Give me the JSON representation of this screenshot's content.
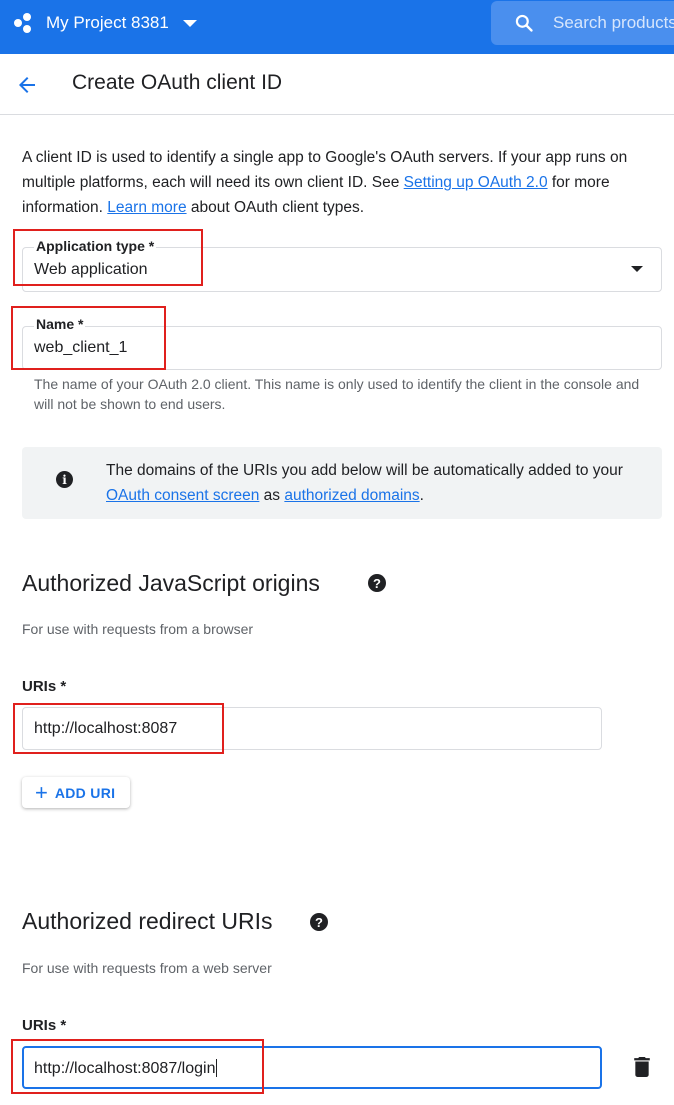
{
  "appbar": {
    "project_name": "My Project 8381",
    "search_placeholder": "Search products",
    "brand_color": "#1a73e8"
  },
  "header": {
    "title": "Create OAuth client ID",
    "back_icon": "arrow-back-icon"
  },
  "intro": {
    "text1": "A client ID is used to identify a single app to Google's OAuth servers. If your app runs on multiple platforms, each will need its own client ID. See ",
    "link1": "Setting up OAuth 2.0",
    "text2": " for more information. ",
    "link2": "Learn more",
    "text3": " about OAuth client types."
  },
  "form": {
    "application_type": {
      "label": "Application type *",
      "value": "Web application"
    },
    "name": {
      "label": "Name *",
      "value": "web_client_1",
      "helper": "The name of your OAuth 2.0 client. This name is only used to identify the client in the console and will not be shown to end users."
    }
  },
  "info": {
    "text1": "The domains of the URIs you add below will be automatically added to your ",
    "link1": "OAuth consent screen",
    "text2": " as ",
    "link2": "authorized domains",
    "text3": "."
  },
  "js_origins": {
    "heading": "Authorized JavaScript origins",
    "subtitle": "For use with requests from a browser",
    "uris_label": "URIs *",
    "uri_value": "http://localhost:8087",
    "add_button": "ADD URI"
  },
  "redirect_uris": {
    "heading": "Authorized redirect URIs",
    "subtitle": "For use with requests from a web server",
    "uris_label": "URIs *",
    "uri_value": "http://localhost:8087/login"
  },
  "colors": {
    "link": "#1a73e8",
    "annotation": "#e0201d"
  }
}
